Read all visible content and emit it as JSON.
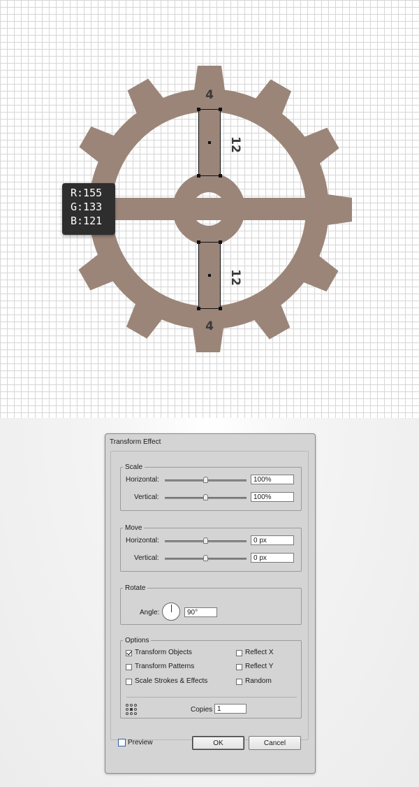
{
  "canvas": {
    "gear_color": "#9b8579",
    "selection_color": "#111111",
    "dimension_labels": {
      "top_tab": "4",
      "bottom_tab": "4",
      "upper_spoke": "12",
      "lower_spoke": "12"
    }
  },
  "color_tooltip": {
    "r": "R:155",
    "g": "G:133",
    "b": "B:121"
  },
  "dialog": {
    "title": "Transform Effect",
    "scale": {
      "legend": "Scale",
      "horizontal_label": "Horizontal:",
      "horizontal_value": "100%",
      "horizontal_slider_position": 0.5,
      "vertical_label": "Vertical:",
      "vertical_value": "100%",
      "vertical_slider_position": 0.5
    },
    "move": {
      "legend": "Move",
      "horizontal_label": "Horizontal:",
      "horizontal_value": "0 px",
      "horizontal_slider_position": 0.5,
      "vertical_label": "Vertical:",
      "vertical_value": "0 px",
      "vertical_slider_position": 0.5
    },
    "rotate": {
      "legend": "Rotate",
      "angle_label": "Angle:",
      "angle_value": "90°"
    },
    "options": {
      "legend": "Options",
      "transform_objects": {
        "label": "Transform Objects",
        "checked": true
      },
      "transform_patterns": {
        "label": "Transform Patterns",
        "checked": false
      },
      "scale_strokes": {
        "label": "Scale Strokes & Effects",
        "checked": false
      },
      "reflect_x": {
        "label": "Reflect X",
        "checked": false
      },
      "reflect_y": {
        "label": "Reflect Y",
        "checked": false
      },
      "random": {
        "label": "Random",
        "checked": false
      },
      "reference_point_icon": "reference-point-grid-icon",
      "copies_label": "Copies",
      "copies_value": "1"
    },
    "preview": {
      "label": "Preview",
      "checked": false
    },
    "ok_label": "OK",
    "cancel_label": "Cancel"
  }
}
